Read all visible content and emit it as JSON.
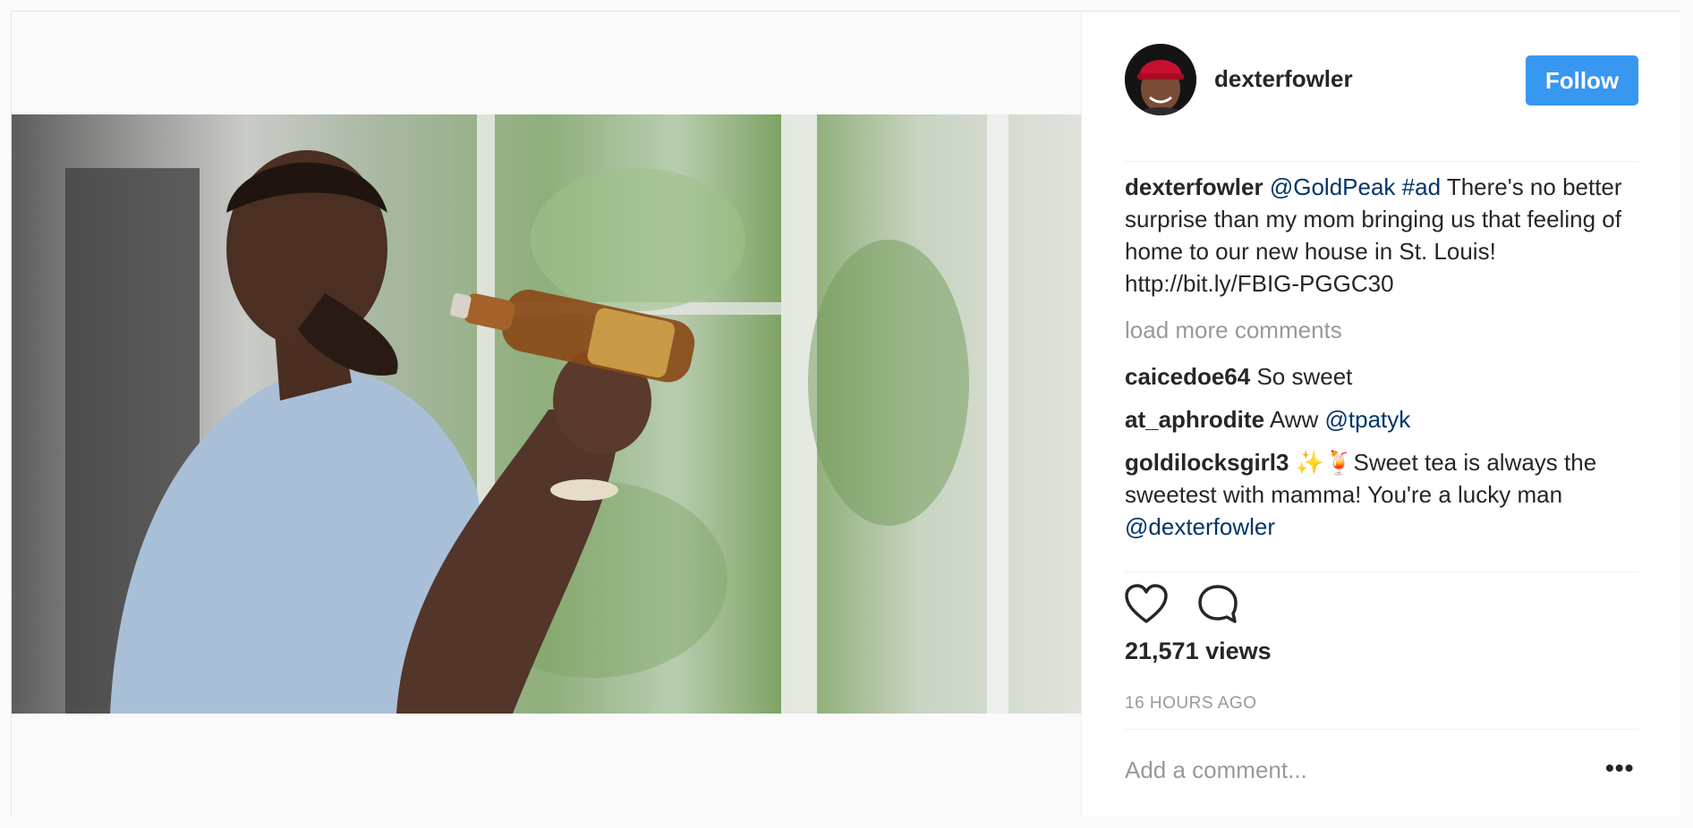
{
  "post": {
    "author": {
      "username": "dexterfowler",
      "follow_label": "Follow"
    },
    "caption": {
      "username": "dexterfowler",
      "mention": "@GoldPeak",
      "hashtag": "#ad",
      "text": "There's no better surprise than my mom bringing us that feeling of home to our new house in St. Louis! http://bit.ly/FBIG-PGGC30"
    },
    "load_more_label": "load more comments",
    "comments": [
      {
        "username": "caicedoe64",
        "text": "So sweet",
        "mention": ""
      },
      {
        "username": "at_aphrodite",
        "text": "Aww",
        "mention": "@tpatyk"
      },
      {
        "username": "goldilocksgirl3",
        "text": "✨🍹Sweet tea is always the sweetest with mamma! You're a lucky man",
        "mention": "@dexterfowler"
      }
    ],
    "views": "21,571 views",
    "timestamp": "16 HOURS AGO",
    "add_comment_placeholder": "Add a comment...",
    "more_label": "•••"
  },
  "icons": {
    "like": "heart-icon",
    "comment": "comment-bubble-icon",
    "more": "more-options-icon"
  },
  "colors": {
    "follow_button": "#3897f0",
    "mention": "#003569",
    "muted": "#999999"
  }
}
